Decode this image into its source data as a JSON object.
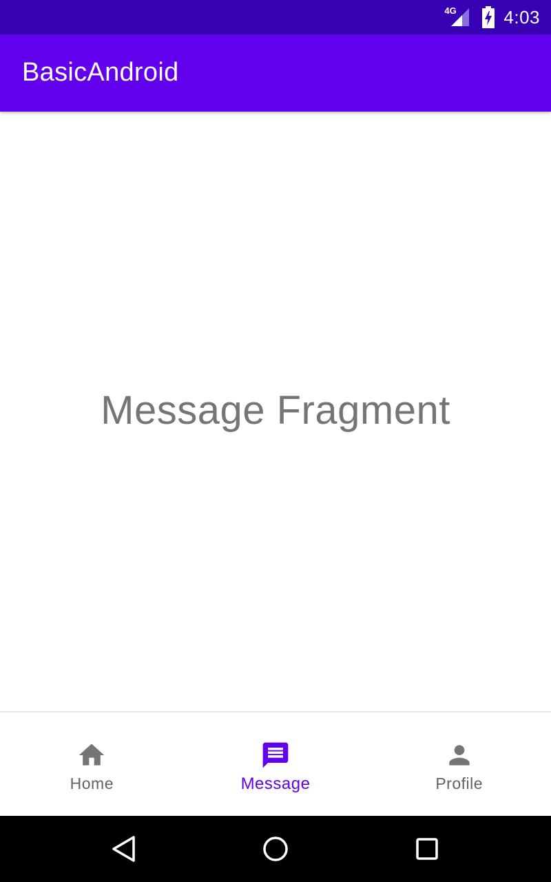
{
  "status_bar": {
    "network_type": "4G",
    "time": "4:03",
    "icons": [
      "signal-icon",
      "battery-charging-icon"
    ]
  },
  "app_bar": {
    "title": "BasicAndroid"
  },
  "content": {
    "fragment_text": "Message Fragment"
  },
  "bottom_nav": {
    "items": [
      {
        "label": "Home",
        "icon": "home-icon",
        "active": false
      },
      {
        "label": "Message",
        "icon": "message-icon",
        "active": true
      },
      {
        "label": "Profile",
        "icon": "profile-icon",
        "active": false
      }
    ],
    "active_color": "#6200ee",
    "inactive_color": "#757575"
  },
  "system_nav": {
    "icons": [
      "back-icon",
      "home-circle-icon",
      "recents-icon"
    ]
  },
  "colors": {
    "status_bar": "#3700b3",
    "app_bar": "#6200ee",
    "fragment_text": "#757575"
  }
}
